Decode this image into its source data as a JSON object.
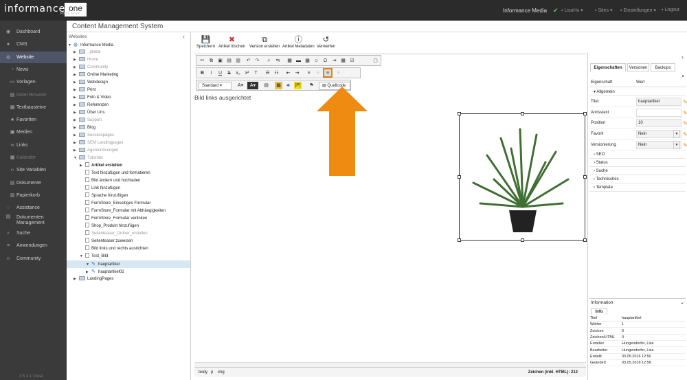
{
  "app": {
    "logo": "informance",
    "logo_box": "one",
    "logo_sub": "Portal Server",
    "org": "Informance Media",
    "user": "LisaHu",
    "sites": "Sites",
    "settings": "Einstellungen",
    "logout": "Logout"
  },
  "sidebar": {
    "items": [
      {
        "label": "Dashboard",
        "icon": "dashboard-icon",
        "glyph": "◉"
      },
      {
        "label": "CMS",
        "icon": "cms-icon",
        "glyph": "●"
      },
      {
        "label": "Website",
        "icon": "globe-icon",
        "glyph": "◍"
      },
      {
        "label": "News",
        "icon": "rss-icon",
        "glyph": "◔"
      },
      {
        "label": "Vorlagen",
        "icon": "template-icon",
        "glyph": "▭"
      },
      {
        "label": "Datei Browser",
        "icon": "file-browser-icon",
        "glyph": "▤"
      },
      {
        "label": "Textbausteine",
        "icon": "textblock-icon",
        "glyph": "▦"
      },
      {
        "label": "Favoriten",
        "icon": "star-icon",
        "glyph": "★"
      },
      {
        "label": "Medien",
        "icon": "media-icon",
        "glyph": "▣"
      },
      {
        "label": "Links",
        "icon": "link-icon",
        "glyph": "∞"
      },
      {
        "label": "Kalender",
        "icon": "calendar-icon",
        "glyph": "▦"
      },
      {
        "label": "Site Variablen",
        "icon": "code-icon",
        "glyph": "‹›"
      },
      {
        "label": "Dokumente",
        "icon": "document-icon",
        "glyph": "▤"
      },
      {
        "label": "Papierkorb",
        "icon": "trash-icon",
        "glyph": "▥"
      },
      {
        "label": "Assistance",
        "icon": "assistance-icon",
        "glyph": "◌"
      },
      {
        "label": "Dokumenten Management",
        "icon": "dms-icon",
        "glyph": "▤"
      },
      {
        "label": "Suche",
        "icon": "search-icon",
        "glyph": "⌕"
      },
      {
        "label": "Anwendungen",
        "icon": "apps-icon",
        "glyph": "≡"
      },
      {
        "label": "Community",
        "icon": "community-icon",
        "glyph": "☺"
      }
    ],
    "version": "3.5.3.1 Vocal"
  },
  "cms_title": "Content Management System",
  "tree": {
    "header": "Websites",
    "rows": [
      {
        "label": "Informance Media",
        "type": "globe"
      },
      {
        "label": "_global",
        "type": "folder",
        "gray": true
      },
      {
        "label": "Home",
        "type": "folder",
        "gray": true
      },
      {
        "label": "Community",
        "type": "folder",
        "gray": true
      },
      {
        "label": "Online Marketing",
        "type": "folder"
      },
      {
        "label": "Webdesign",
        "type": "folder"
      },
      {
        "label": "Print",
        "type": "folder"
      },
      {
        "label": "Foto & Video",
        "type": "folder"
      },
      {
        "label": "Referenzen",
        "type": "folder"
      },
      {
        "label": "Über Uns",
        "type": "folder"
      },
      {
        "label": "Support",
        "type": "folder",
        "gray": true
      },
      {
        "label": "Blog",
        "type": "folder"
      },
      {
        "label": "Successpages",
        "type": "folder",
        "gray": true
      },
      {
        "label": "SEM Landingpages",
        "type": "folder",
        "gray": true
      },
      {
        "label": "Agenturlösungen",
        "type": "folder",
        "gray": true
      },
      {
        "label": "Tutorials",
        "type": "folder",
        "gray": true,
        "open": true
      },
      {
        "label": "Artikel erstellen",
        "type": "page",
        "bold": true
      },
      {
        "label": "Text hinzufügen und formatieren",
        "type": "page"
      },
      {
        "label": "Bild ändern und hochladen",
        "type": "page"
      },
      {
        "label": "Link hinzufügen",
        "type": "page"
      },
      {
        "label": "Sprache hinzufügen",
        "type": "page"
      },
      {
        "label": "FormStore_Einseitiges Formular",
        "type": "page"
      },
      {
        "label": "FormStore_Formular mit Abhängigkeiten",
        "type": "page"
      },
      {
        "label": "FormStore_Formular verlinken",
        "type": "page"
      },
      {
        "label": "Shop_Produkt hinzufügen",
        "type": "page"
      },
      {
        "label": "Seitenteaser_Ordner_erstellen",
        "type": "page",
        "gray": true
      },
      {
        "label": "Seitenteaser zuweisen",
        "type": "page"
      },
      {
        "label": "Bild links und rechts ausrichten",
        "type": "page"
      },
      {
        "label": "Test_Bild",
        "type": "page",
        "open": true
      },
      {
        "label": "hauptartikel",
        "type": "article",
        "sel": true
      },
      {
        "label": "hauptartikel02",
        "type": "article"
      },
      {
        "label": "LandingPages",
        "type": "folder"
      }
    ]
  },
  "actions": [
    {
      "label": "Speichern",
      "icon": "save-icon",
      "glyph": "💾"
    },
    {
      "label": "Artikel löschen",
      "icon": "delete-article-icon",
      "glyph": "✖"
    },
    {
      "label": "Version erstellen",
      "icon": "version-icon",
      "glyph": "⧉"
    },
    {
      "label": "Artikel Metadaten",
      "icon": "metadata-icon",
      "glyph": "ⓘ"
    },
    {
      "label": "Verwerfen",
      "icon": "discard-icon",
      "glyph": "↺"
    }
  ],
  "toolbar": {
    "style": "Standard",
    "source": "Quellcode"
  },
  "content_text": "Bild links ausgerichtet",
  "status": {
    "path": [
      "body",
      "p",
      "img"
    ],
    "chars": "Zeichen (inkl. HTML): 212"
  },
  "right": {
    "tabs": [
      "Eigenschaften",
      "Versionen",
      "Backups"
    ],
    "col1": "Eigenschaft",
    "col2": "Wert",
    "group": "Allgemein",
    "props": [
      {
        "k": "Titel",
        "v": "hauptartikel"
      },
      {
        "k": "Anriss­text",
        "v": ""
      },
      {
        "k": "Position",
        "v": "10"
      },
      {
        "k": "Favorit",
        "v": "Nein"
      },
      {
        "k": "Versionierung",
        "v": "Nein"
      }
    ],
    "sections": [
      "SEO",
      "Status",
      "Suche",
      "Technisches",
      "Template"
    ],
    "info_title": "Information",
    "info_tab": "Info",
    "info": [
      {
        "k": "Titel",
        "v": "hauptartikel"
      },
      {
        "k": "Wörter",
        "v": "1"
      },
      {
        "k": "Zeichen",
        "v": "0"
      },
      {
        "k": "Zeichen/HTML",
        "v": "0"
      },
      {
        "k": "Ersteller",
        "v": "Hungendorfer, Lisa"
      },
      {
        "k": "Bearbeiter",
        "v": "Hungendorfer, Lisa"
      },
      {
        "k": "Erstellt",
        "v": "03.05.2016 12:50"
      },
      {
        "k": "Geändert",
        "v": "03.05.2016 12:58"
      }
    ]
  }
}
